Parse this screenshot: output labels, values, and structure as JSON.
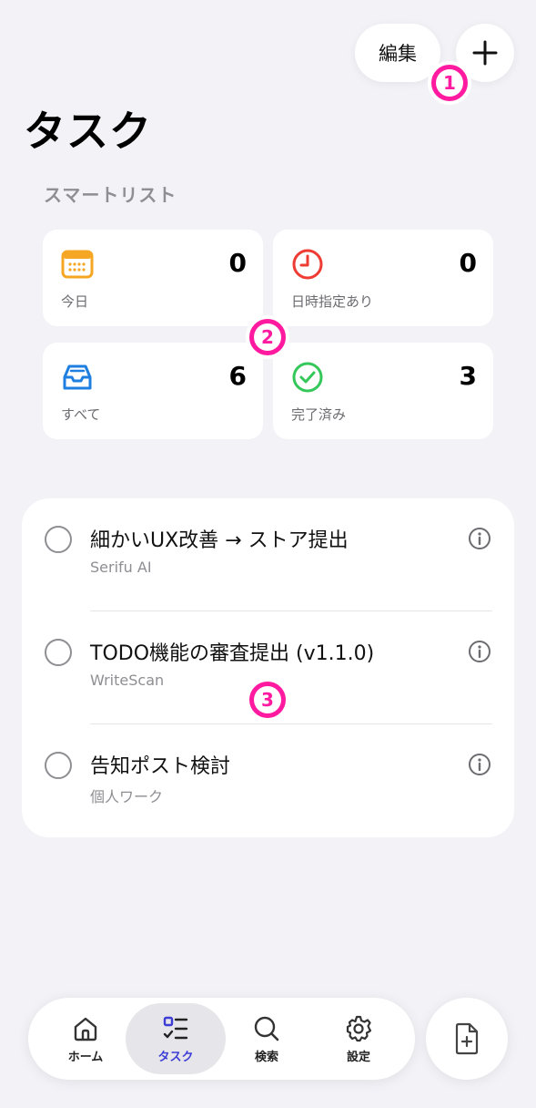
{
  "header": {
    "edit_label": "編集",
    "add_icon": "plus-icon"
  },
  "page_title": "タスク",
  "section_label": "スマートリスト",
  "smart_lists": [
    {
      "label": "今日",
      "count": "0",
      "icon": "calendar-icon",
      "color": "#f5a623"
    },
    {
      "label": "日時指定あり",
      "count": "0",
      "icon": "clock-icon",
      "color": "#ee3b33"
    },
    {
      "label": "すべて",
      "count": "6",
      "icon": "inbox-icon",
      "color": "#1f7fe0"
    },
    {
      "label": "完了済み",
      "count": "3",
      "icon": "checkmark-circle-icon",
      "color": "#34c759"
    }
  ],
  "tasks": [
    {
      "title": "細かいUX改善 → ストア提出",
      "project": "Serifu AI"
    },
    {
      "title": "TODO機能の審査提出 (v1.1.0)",
      "project": "WriteScan"
    },
    {
      "title": "告知ポスト検討",
      "project": "個人ワーク"
    }
  ],
  "tab_bar": {
    "tabs": [
      {
        "label": "ホーム",
        "icon": "home-icon",
        "active": false
      },
      {
        "label": "タスク",
        "icon": "task-list-icon",
        "active": true
      },
      {
        "label": "検索",
        "icon": "search-icon",
        "active": false
      },
      {
        "label": "設定",
        "icon": "gear-icon",
        "active": false
      }
    ],
    "fab_icon": "new-document-icon"
  },
  "annotations": {
    "marker_1": "1",
    "marker_2": "2",
    "marker_3": "3",
    "marker_color": "#ff1aa0"
  },
  "colors": {
    "background": "#f2f2f7",
    "accent": "#3d3dd6"
  }
}
